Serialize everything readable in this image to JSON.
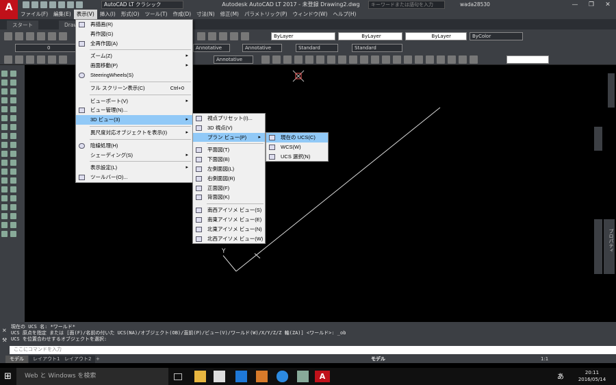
{
  "app": {
    "logo_text": "A",
    "workspace": "AutoCAD LT クラシック",
    "title": "Autodesk AutoCAD LT 2017 - 未登録    Drawing2.dwg",
    "keyword_placeholder": "キーワードまたは語句を入力",
    "user": "wada28530"
  },
  "menubar": [
    "ファイル(F)",
    "編集(E)",
    "表示(V)",
    "挿入(I)",
    "形式(O)",
    "ツール(T)",
    "作成(D)",
    "寸法(N)",
    "修正(M)",
    "パラメトリック(P)",
    "ウィンドウ(W)",
    "ヘルプ(H)"
  ],
  "file_tabs": [
    "スタート",
    "Drawing2"
  ],
  "ribbon": {
    "layer_combo1": "ByLayer",
    "layer_combo2": "ByLayer",
    "layer_combo3": "ByLayer",
    "layer_combo4": "ByColor",
    "layer_name": "0",
    "annotative1": "Annotative",
    "annotative2": "Annotative",
    "standard1": "Standard",
    "standard2": "Standard",
    "annotative3": "Annotative"
  },
  "view_menu": [
    {
      "label": "再描画(R)"
    },
    {
      "label": "再作図(G)"
    },
    {
      "label": "全再作図(A)"
    },
    {
      "label": "ズーム(Z)",
      "submenu": true
    },
    {
      "label": "画面移動(P)",
      "submenu": true
    },
    {
      "label": "SteeringWheels(S)"
    },
    {
      "label": "フル スクリーン表示(C)",
      "shortcut": "Ctrl+0"
    },
    {
      "label": "ビューポート(V)",
      "submenu": true
    },
    {
      "label": "ビュー管理(N)..."
    },
    {
      "label": "3D ビュー(3)",
      "submenu": true
    },
    {
      "label": "異尺度対応オブジェクトを表示(I)",
      "submenu": true
    },
    {
      "label": "陰線処理(H)"
    },
    {
      "label": "シェーディング(S)",
      "submenu": true
    },
    {
      "label": "表示設定(L)",
      "submenu": true
    },
    {
      "label": "ツールバー(O)..."
    }
  ],
  "view3d_menu": [
    "視点プリセット(I)...",
    "3D 視点(V)",
    "プラン ビュー(P)",
    "平面図(T)",
    "下面図(B)",
    "左側面図(L)",
    "右側面図(R)",
    "正面図(F)",
    "背面図(K)",
    "南西アイソメ ビュー(S)",
    "南東アイソメ ビュー(E)",
    "北東アイソメ ビュー(N)",
    "北西アイソメ ビュー(W)"
  ],
  "plan_menu": [
    "現在の UCS(C)",
    "WCS(W)",
    "UCS 選択(N)"
  ],
  "canvas": {
    "y_label": "Y",
    "right_panel_label": "プロパティ"
  },
  "command": {
    "line1": "現在の UCS 名:  *ワールド*",
    "line2": "UCS 原点を指定 または [面(F)/名前の付いた UCS(NA)/オブジェクト(OB)/直前(P)/ビュー(V)/ワールド(W)/X/Y/Z/Z 軸(ZA)] <ワールド>: _ob",
    "line3": "UCS を位置合わせするオブジェクトを選択:",
    "placeholder": "ここにコマンドを入力"
  },
  "layout_tabs": [
    "モデル",
    "レイアウト1",
    "レイアウト2",
    "+"
  ],
  "status": {
    "model": "モデル",
    "scale": "1:1"
  },
  "taskbar": {
    "search": "Web と Windows を検索",
    "time": "20:11",
    "date": "2016/05/14",
    "ime": "あ"
  }
}
